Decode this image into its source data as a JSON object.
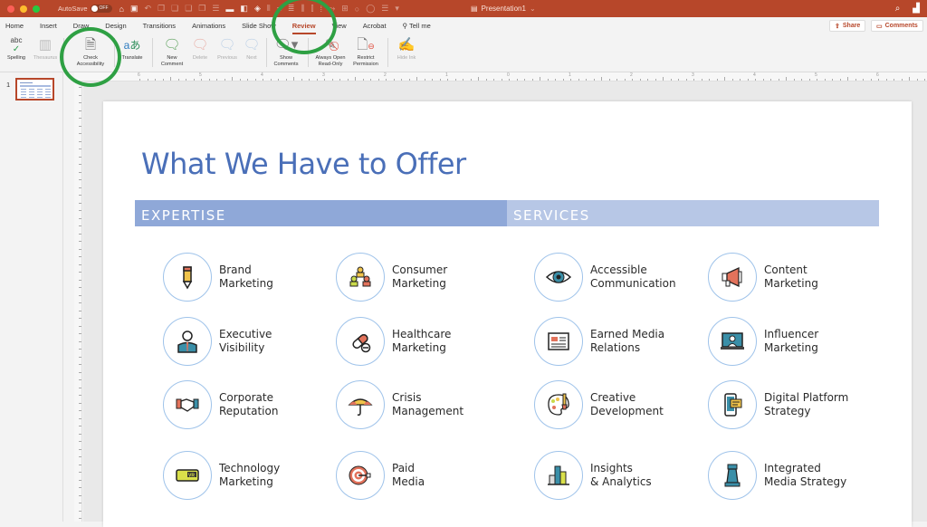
{
  "window": {
    "autosave_label": "AutoSave",
    "autosave_state": "OFF",
    "doc_title": "Presentation1",
    "doc_title_caret": "⌄"
  },
  "tabs": [
    {
      "label": "Home",
      "active": false
    },
    {
      "label": "Insert",
      "active": false
    },
    {
      "label": "Draw",
      "active": false
    },
    {
      "label": "Design",
      "active": false
    },
    {
      "label": "Transitions",
      "active": false
    },
    {
      "label": "Animations",
      "active": false
    },
    {
      "label": "Slide Show",
      "active": false
    },
    {
      "label": "Review",
      "active": true
    },
    {
      "label": "View",
      "active": false
    },
    {
      "label": "Acrobat",
      "active": false
    },
    {
      "label": "Tell me",
      "active": false
    }
  ],
  "header_actions": {
    "share": "Share",
    "comments": "Comments"
  },
  "ribbon": {
    "spelling": "Spelling",
    "thesaurus": "Thesaurus",
    "check_accessibility_1": "Check",
    "check_accessibility_2": "Accessibility",
    "translate": "Translate",
    "new_comment_1": "New",
    "new_comment_2": "Comment",
    "delete": "Delete",
    "previous": "Previous",
    "next": "Next",
    "show_comments_1": "Show",
    "show_comments_2": "Comments",
    "always_open_1": "Always Open",
    "always_open_2": "Read-Only",
    "restrict_1": "Restrict",
    "restrict_2": "Permission",
    "hide_ink": "Hide Ink"
  },
  "thumbnails": {
    "slide_number": "1"
  },
  "ruler": {
    "h_labels": [
      "6",
      "5",
      "4",
      "3",
      "2",
      "1",
      "0",
      "1",
      "2",
      "3",
      "4",
      "5",
      "6"
    ]
  },
  "slide": {
    "title": "What We Have to Offer",
    "expertise_header": "EXPERTISE",
    "services_header": "SERVICES",
    "expertise": [
      {
        "line1": "Brand",
        "line2": "Marketing",
        "icon": "pencil-icon"
      },
      {
        "line1": "Consumer",
        "line2": "Marketing",
        "icon": "people-group-icon"
      },
      {
        "line1": "Executive",
        "line2": "Visibility",
        "icon": "executive-person-icon"
      },
      {
        "line1": "Healthcare",
        "line2": "Marketing",
        "icon": "pill-icon"
      },
      {
        "line1": "Corporate",
        "line2": "Reputation",
        "icon": "handshake-icon"
      },
      {
        "line1": "Crisis",
        "line2": "Management",
        "icon": "umbrella-icon"
      },
      {
        "line1": "Technology",
        "line2": "Marketing",
        "icon": "vr-headset-icon"
      },
      {
        "line1": "Paid",
        "line2": "Media",
        "icon": "target-icon"
      }
    ],
    "services": [
      {
        "line1": "Accessible",
        "line2": "Communication",
        "icon": "eye-icon"
      },
      {
        "line1": "Content",
        "line2": "Marketing",
        "icon": "megaphone-icon"
      },
      {
        "line1": "Earned Media",
        "line2": "Relations",
        "icon": "newspaper-icon"
      },
      {
        "line1": "Influencer",
        "line2": "Marketing",
        "icon": "laptop-person-icon"
      },
      {
        "line1": "Creative",
        "line2": "Development",
        "icon": "palette-icon"
      },
      {
        "line1": "Digital Platform",
        "line2": "Strategy",
        "icon": "phone-chat-icon"
      },
      {
        "line1": "Insights",
        "line2": "& Analytics",
        "icon": "bar-chart-icon"
      },
      {
        "line1": "Integrated",
        "line2": "Media Strategy",
        "icon": "chess-rook-icon"
      }
    ]
  },
  "colors": {
    "accent": "#b7472a",
    "title_blue": "#4a6fb8",
    "expertise_band": "#8fa8d8",
    "services_band": "#b7c7e6",
    "annotation_green": "#2ea043"
  }
}
